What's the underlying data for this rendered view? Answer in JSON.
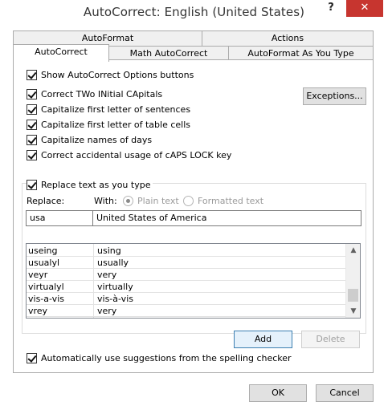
{
  "window": {
    "title": "AutoCorrect: English (United States)",
    "help_label": "?",
    "close_label": "✕"
  },
  "tabs": {
    "row1": [
      "AutoFormat",
      "Actions"
    ],
    "row2": [
      "AutoCorrect",
      "Math AutoCorrect",
      "AutoFormat As You Type"
    ],
    "active": "AutoCorrect"
  },
  "options": {
    "show_buttons": {
      "label": "Show AutoCorrect Options buttons",
      "checked": true
    },
    "two_initial_caps": {
      "label": "Correct TWo INitial CApitals",
      "checked": true
    },
    "cap_sentences": {
      "label": "Capitalize first letter of sentences",
      "checked": true
    },
    "cap_table_cells": {
      "label": "Capitalize first letter of table cells",
      "checked": true
    },
    "cap_days": {
      "label": "Capitalize names of days",
      "checked": true
    },
    "caps_lock": {
      "label": "Correct accidental usage of cAPS LOCK key",
      "checked": true
    },
    "exceptions_label": "Exceptions..."
  },
  "replace": {
    "checkbox_label": "Replace text as you type",
    "checked": true,
    "replace_label": "Replace:",
    "with_label": "With:",
    "plain_text_label": "Plain text",
    "formatted_text_label": "Formatted text",
    "selected_format": "plain",
    "replace_value": "usa",
    "with_value": "United States of America"
  },
  "entries": [
    {
      "replace": "useing",
      "with": "using"
    },
    {
      "replace": "usualyl",
      "with": "usually"
    },
    {
      "replace": "veyr",
      "with": "very"
    },
    {
      "replace": "virtualyl",
      "with": "virtually"
    },
    {
      "replace": "vis-a-vis",
      "with": "vis-à-vis"
    },
    {
      "replace": "vrey",
      "with": "very"
    }
  ],
  "buttons": {
    "add": "Add",
    "delete": "Delete",
    "ok": "OK",
    "cancel": "Cancel"
  },
  "spelling": {
    "label": "Automatically use suggestions from the spelling checker",
    "checked": true
  },
  "icons": {
    "scroll_up": "chevron-up-icon",
    "scroll_down": "chevron-down-icon",
    "check": "checkmark-icon"
  }
}
